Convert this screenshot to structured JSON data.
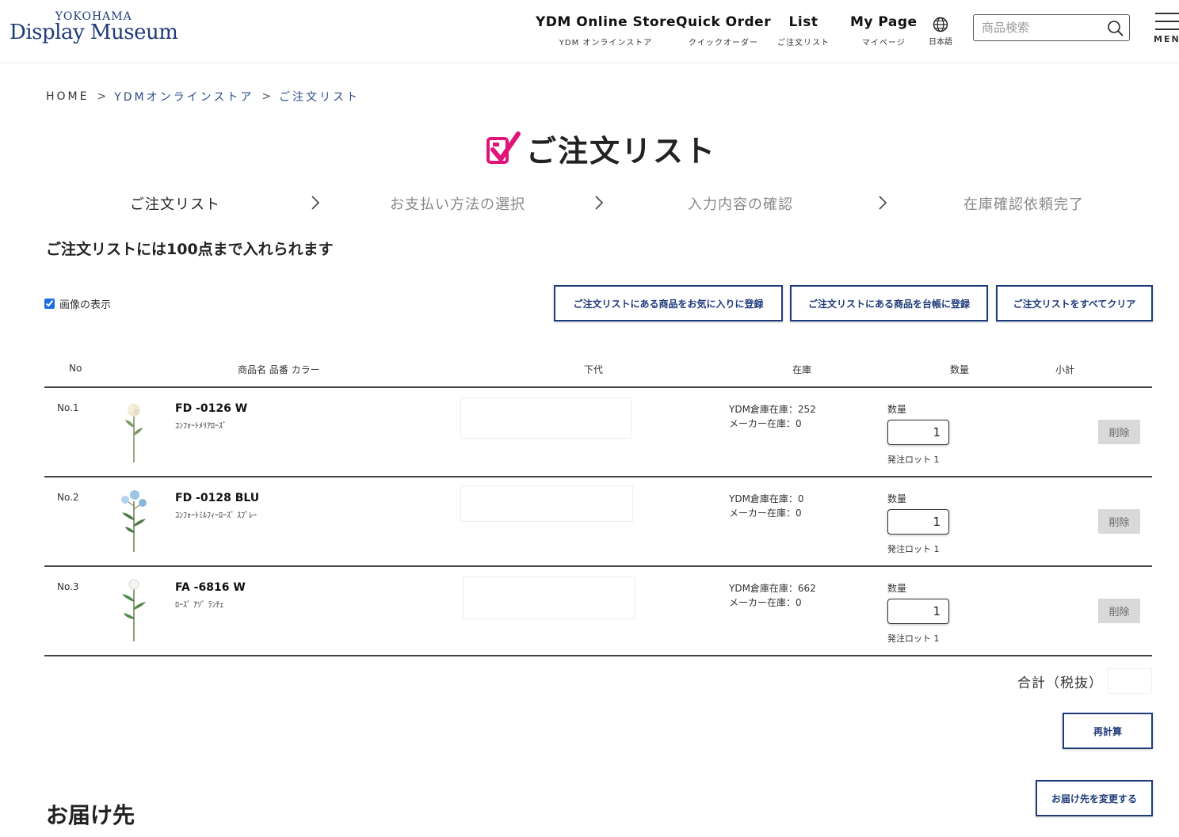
{
  "header": {
    "logo_small": "YOKOHAMA",
    "logo_big": "Display Museum",
    "nav": [
      {
        "en": "YDM Online Store",
        "ja": "YDM オンラインストア"
      },
      {
        "en": "Quick Order",
        "ja": "クイックオーダー"
      },
      {
        "en": "List",
        "ja": "ご注文リスト"
      },
      {
        "en": "My Page",
        "ja": "マイページ"
      }
    ],
    "lang_label": "日本語",
    "search_placeholder": "商品検索",
    "menu_label": "MENU"
  },
  "breadcrumb": {
    "home": "HOME",
    "store": "YDMオンラインストア",
    "current": "ご注文リスト"
  },
  "page_title": "ご注文リスト",
  "steps": [
    {
      "label": "ご注文リスト",
      "active": true
    },
    {
      "label": "お支払い方法の選択",
      "active": false
    },
    {
      "label": "入力内容の確認",
      "active": false
    },
    {
      "label": "在庫確認依頼完了",
      "active": false
    }
  ],
  "notice": "ご注文リストには100点まで入れられます",
  "image_toggle_label": "画像の表示",
  "actions": {
    "favorites": "ご注文リストにある商品をお気に入りに登録",
    "ledger": "ご注文リストにある商品を台帳に登録",
    "clear_all": "ご注文リストをすべてクリア"
  },
  "table": {
    "headers": {
      "no": "No",
      "name": "商品名 品番 カラー",
      "price": "下代",
      "stock": "在庫",
      "qty": "数量",
      "subtotal": "小計"
    },
    "rows": [
      {
        "no": "No.1",
        "code": "FD -0126 W",
        "name": "ｺﾝﾌｫｰﾄﾒﾘｱﾛｰｽﾞ",
        "stock_ydm": "YDM倉庫在庫：252",
        "stock_maker": "メーカー在庫：0",
        "qty_label": "数量",
        "qty": "1",
        "lot": "発注ロット 1",
        "delete": "削除"
      },
      {
        "no": "No.2",
        "code": "FD -0128 BLU",
        "name": "ｺﾝﾌｫｰﾄﾐﾙﾌｨｰﾛｰｽﾞ ｽﾌﾟﾚｰ",
        "stock_ydm": "YDM倉庫在庫：0",
        "stock_maker": "メーカー在庫：0",
        "qty_label": "数量",
        "qty": "1",
        "lot": "発注ロット 1",
        "delete": "削除"
      },
      {
        "no": "No.3",
        "code": "FA -6816 W",
        "name": "ﾛｰｽﾞ ｱｿﾞ ﾗﾝﾁｪ",
        "stock_ydm": "YDM倉庫在庫：662",
        "stock_maker": "メーカー在庫：0",
        "qty_label": "数量",
        "qty": "1",
        "lot": "発注ロット 1",
        "delete": "削除"
      }
    ]
  },
  "total_label": "合計（税抜）",
  "recalc_label": "再計算",
  "change_delivery_label": "お届け先を変更する",
  "delivery_title": "お届け先",
  "colors": {
    "brand_navy": "#1f3b7a",
    "accent_pink": "#e0157a"
  }
}
